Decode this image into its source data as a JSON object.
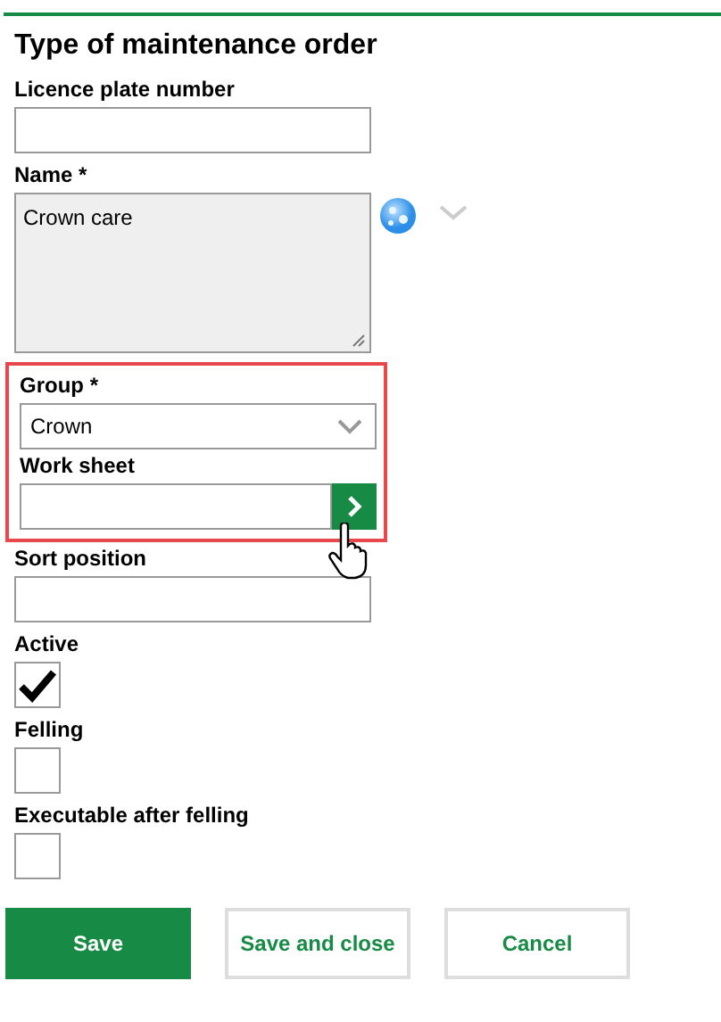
{
  "title": "Type of maintenance order",
  "fields": [
    {
      "kind": "text",
      "label": "Licence plate number"
    },
    {
      "kind": "textarea",
      "label": "Name *",
      "value": "Crown care"
    },
    {
      "kind": "highlight",
      "fields": [
        {
          "kind": "select",
          "label": "Group *",
          "value": "Crown"
        },
        {
          "kind": "lookup",
          "label": "Work sheet"
        }
      ]
    },
    {
      "kind": "text",
      "label": "Sort position"
    },
    {
      "kind": "checkbox",
      "label": "Active",
      "checked": true
    },
    {
      "kind": "checkbox",
      "label": "Felling",
      "checked": false
    },
    {
      "kind": "checkbox",
      "label": "Executable after felling",
      "checked": false
    }
  ],
  "buttons": [
    {
      "label": "Save",
      "primary": true
    },
    {
      "label": "Save and close",
      "primary": false
    },
    {
      "label": "Cancel",
      "primary": false
    }
  ]
}
